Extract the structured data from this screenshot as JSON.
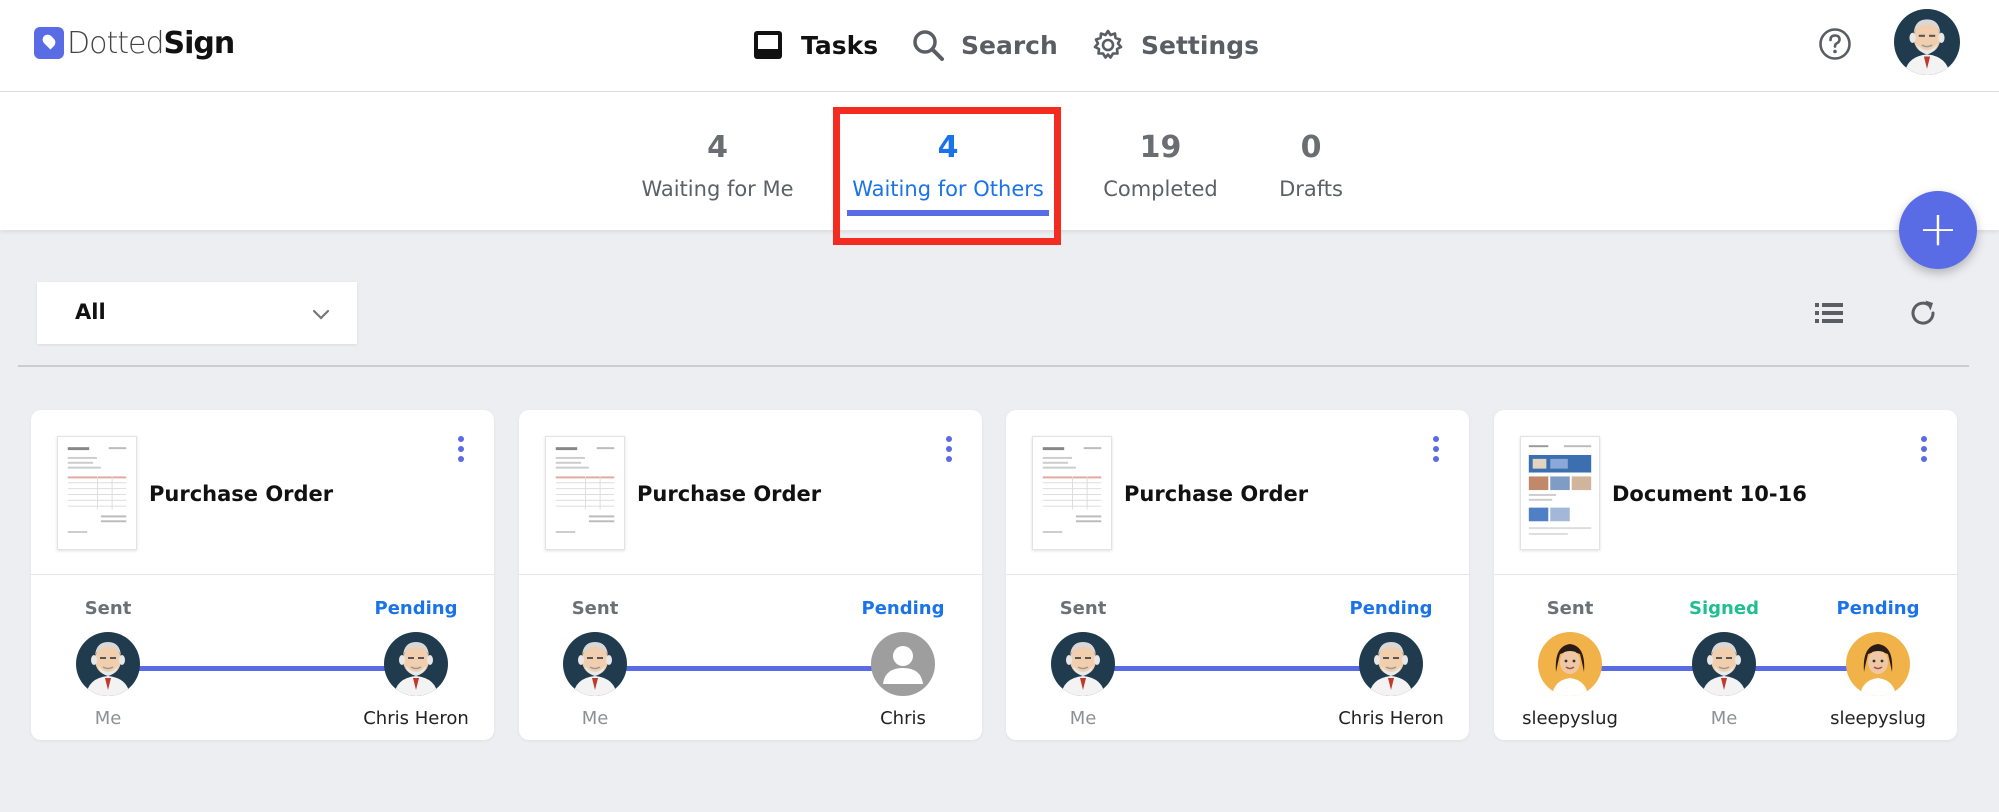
{
  "brand": {
    "name_light": "Dotted",
    "name_bold": "Sign"
  },
  "nav": {
    "tasks": "Tasks",
    "search": "Search",
    "settings": "Settings"
  },
  "tabs": [
    {
      "count": "4",
      "label": "Waiting for Me"
    },
    {
      "count": "4",
      "label": "Waiting for Others"
    },
    {
      "count": "19",
      "label": "Completed"
    },
    {
      "count": "0",
      "label": "Drafts"
    }
  ],
  "active_tab": "Waiting for Others",
  "fab_label": "+",
  "filter": {
    "selected": "All"
  },
  "colors": {
    "accent": "#5a6be6",
    "link_blue": "#1a73e8",
    "signed_green": "#1fbf8f",
    "highlight_red": "#f42b21"
  },
  "cards": [
    {
      "title": "Purchase Order",
      "steps": [
        {
          "status": "Sent",
          "name": "Me",
          "avatar": "old-man-avatar"
        },
        {
          "status": "Pending",
          "name": "Chris Heron",
          "avatar": "old-man-avatar"
        }
      ]
    },
    {
      "title": "Purchase Order",
      "steps": [
        {
          "status": "Sent",
          "name": "Me",
          "avatar": "old-man-avatar"
        },
        {
          "status": "Pending",
          "name": "Chris",
          "avatar": "default-person-icon"
        }
      ]
    },
    {
      "title": "Purchase Order",
      "steps": [
        {
          "status": "Sent",
          "name": "Me",
          "avatar": "old-man-avatar"
        },
        {
          "status": "Pending",
          "name": "Chris Heron",
          "avatar": "old-man-avatar"
        }
      ]
    },
    {
      "title": "Document 10-16",
      "steps": [
        {
          "status": "Sent",
          "name": "sleepyslug",
          "avatar": "woman-avatar"
        },
        {
          "status": "Signed",
          "name": "Me",
          "avatar": "old-man-avatar"
        },
        {
          "status": "Pending",
          "name": "sleepyslug",
          "avatar": "woman-avatar"
        }
      ]
    }
  ]
}
